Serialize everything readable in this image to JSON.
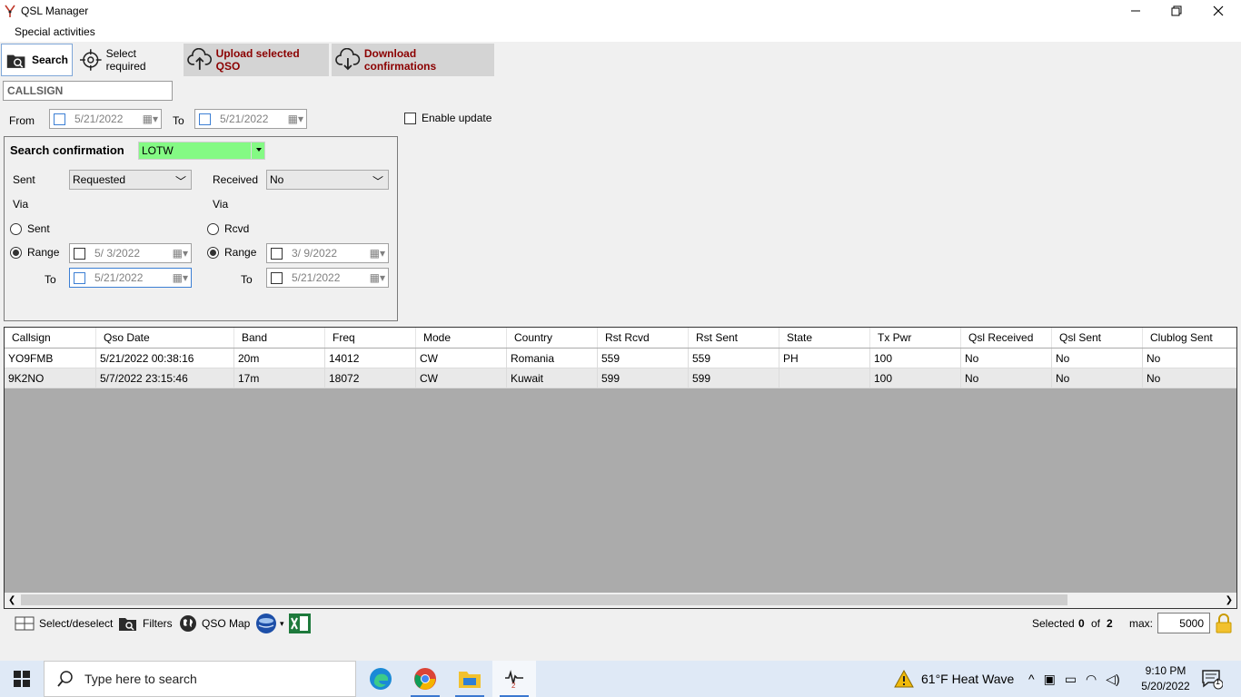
{
  "window": {
    "title": "QSL Manager"
  },
  "menu": {
    "items": [
      "Special activities"
    ]
  },
  "toolbar": {
    "search": "Search",
    "select_required": "Select required",
    "upload": "Upload selected QSO",
    "download": "Download confirmations"
  },
  "filters": {
    "callsign_placeholder": "CALLSIGN",
    "from_label": "From",
    "from_date": "5/21/2022",
    "to_label": "To",
    "to_date": "5/21/2022",
    "enable_update": "Enable update"
  },
  "confirmation": {
    "title": "Search confirmation",
    "service": "LOTW",
    "sent_label": "Sent",
    "sent_value": "Requested",
    "received_label": "Received",
    "received_value": "No",
    "via_label": "Via",
    "sent_radio": "Sent",
    "rcvd_radio": "Rcvd",
    "range_label": "Range",
    "to_label": "To",
    "sent_range_from": "5/  3/2022",
    "sent_range_to": "5/21/2022",
    "rcvd_range_from": "3/  9/2022",
    "rcvd_range_to": "5/21/2022"
  },
  "grid": {
    "columns": [
      "Callsign",
      "Qso Date",
      "Band",
      "Freq",
      "Mode",
      "Country",
      "Rst Rcvd",
      "Rst Sent",
      "State",
      "Tx Pwr",
      "Qsl Received",
      "Qsl Sent",
      "Clublog Sent"
    ],
    "rows": [
      [
        "YO9FMB",
        "5/21/2022 00:38:16",
        "20m",
        "14012",
        "CW",
        "Romania",
        "559",
        "559",
        "PH",
        "100",
        "No",
        "No",
        "No"
      ],
      [
        "9K2NO",
        "5/7/2022 23:15:46",
        "17m",
        "18072",
        "CW",
        "Kuwait",
        "599",
        "599",
        "",
        "100",
        "No",
        "No",
        "No"
      ]
    ]
  },
  "bottom": {
    "select_deselect": "Select/deselect",
    "filters": "Filters",
    "qso_map": "QSO Map",
    "selected_label": "Selected",
    "selected_count": "0",
    "of_label": "of",
    "total_count": "2",
    "max_label": "max:",
    "max_value": "5000"
  },
  "taskbar": {
    "search_placeholder": "Type here to search",
    "weather": "61°F  Heat Wave",
    "time": "9:10 PM",
    "date": "5/20/2022",
    "notification_count": "1"
  }
}
